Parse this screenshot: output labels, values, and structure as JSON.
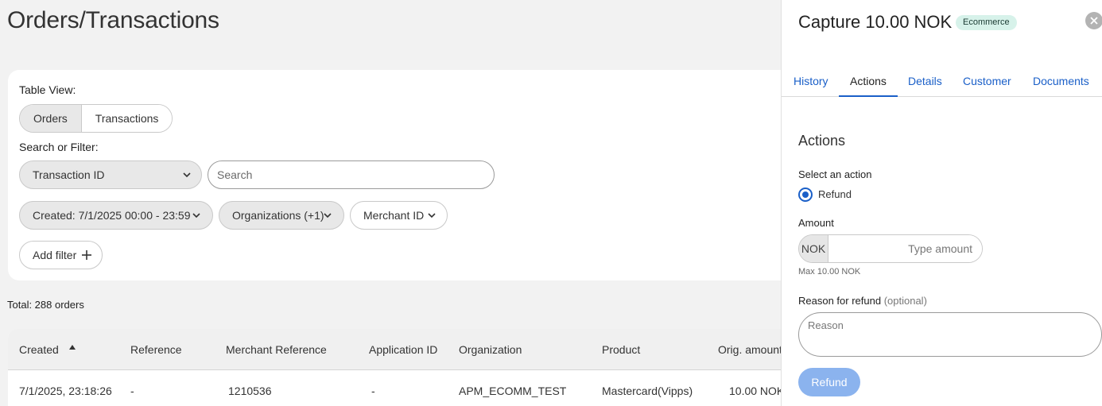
{
  "page": {
    "title": "Orders/Transactions"
  },
  "filters": {
    "table_view_label": "Table View:",
    "view_options": [
      "Orders",
      "Transactions"
    ],
    "search_label": "Search or Filter:",
    "search_field_select": "Transaction ID",
    "search_placeholder": "Search",
    "chips": [
      "Created: 7/1/2025 00:00 - 23:59",
      "Organizations (+1)",
      "Merchant ID"
    ],
    "add_filter": "Add filter"
  },
  "summary": {
    "total": "Total: 288 orders"
  },
  "table": {
    "columns": [
      "Created",
      "Reference",
      "Merchant Reference",
      "Application ID",
      "Organization",
      "Product",
      "Orig. amount"
    ],
    "rows": [
      [
        "7/1/2025, 23:18:26",
        "-",
        "1210536",
        "-",
        "APM_ECOMM_TEST",
        "Mastercard(Vipps)",
        "10.00 NOK"
      ]
    ]
  },
  "panel": {
    "title": "Capture 10.00 NOK",
    "badge": "Ecommerce",
    "tabs": [
      "History",
      "Actions",
      "Details",
      "Customer",
      "Documents"
    ],
    "active_tab": "Actions",
    "section_title": "Actions",
    "select_action_label": "Select an action",
    "action_option": "Refund",
    "amount_label": "Amount",
    "currency": "NOK",
    "amount_placeholder": "Type amount",
    "max_hint": "Max 10.00 NOK",
    "reason_label": "Reason for refund",
    "reason_optional": "(optional)",
    "reason_placeholder": "Reason",
    "submit_label": "Refund"
  },
  "colors": {
    "accent": "#1a5fc8",
    "badge_bg": "#d7f2ea",
    "refund_button_disabled": "#8bb3ee"
  },
  "icons": {
    "dropdown": "chevron-down-icon",
    "add": "plus-icon",
    "sort": "sort-ascending-icon",
    "close": "close-icon"
  }
}
